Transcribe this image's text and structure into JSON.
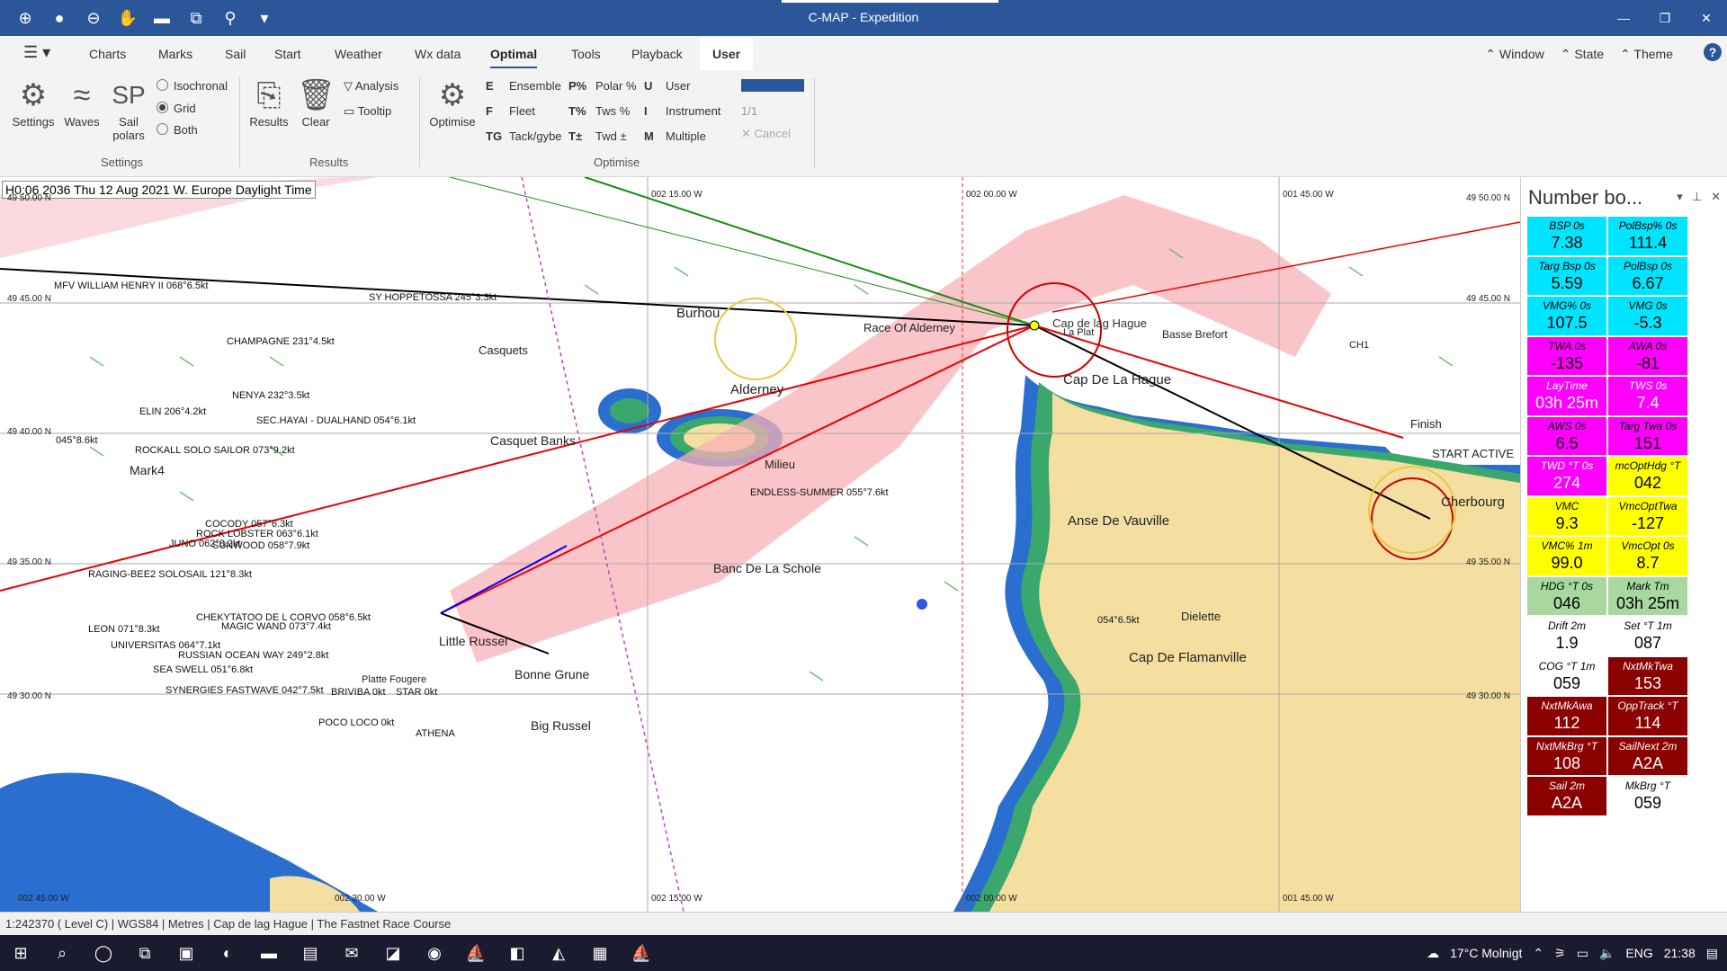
{
  "window": {
    "title": "C-MAP - Expedition"
  },
  "quick_access": [
    "zoom-in-icon",
    "circle-icon",
    "zoom-out-icon",
    "hand-icon",
    "eraser-icon",
    "frame-icon",
    "route-icon",
    "dropdown-icon"
  ],
  "tabs": [
    "Charts",
    "Marks",
    "Sail",
    "Start",
    "Weather",
    "Wx data",
    "Optimal",
    "Tools",
    "Playback",
    "User"
  ],
  "tab_right": {
    "window": "Window",
    "state": "State",
    "theme": "Theme",
    "help": "?"
  },
  "ribbon": {
    "settings": "Settings",
    "waves": "Waves",
    "sail_polars_icon": "SP",
    "sail_polars": "Sail polars",
    "isochronal": "Isochronal",
    "grid": "Grid",
    "both": "Both",
    "settings_group": "Settings",
    "results": "Results",
    "clear": "Clear",
    "analysis": "Analysis",
    "tooltip": "Tooltip",
    "results_group": "Results",
    "optimise": "Optimise",
    "opt_items": [
      {
        "key": "E",
        "label": "Ensemble"
      },
      {
        "key": "F",
        "label": "Fleet"
      },
      {
        "key": "TG",
        "label": "Tack/gybe"
      },
      {
        "key": "P%",
        "label": "Polar %"
      },
      {
        "key": "T%",
        "label": "Tws %"
      },
      {
        "key": "T±",
        "label": "Twd ±"
      },
      {
        "key": "U",
        "label": "User"
      },
      {
        "key": "I",
        "label": "Instrument"
      },
      {
        "key": "M",
        "label": "Multiple"
      }
    ],
    "progress": "1/1",
    "cancel": "Cancel",
    "optimise_group": "Optimise"
  },
  "map": {
    "header": "H0:06 2036 Thu 12 Aug 2021 W. Europe Daylight Time",
    "places": [
      "Burhou",
      "Race Of Alderney",
      "Cap de lag Hague",
      "La Plat",
      "Basse Brefort",
      "Cap De La Hague",
      "Alderney",
      "Casquet Banks",
      "Casquets",
      "Milieu",
      "Anse De Vauville",
      "Banc De La Schole",
      "Little Russel",
      "Bonne Grune",
      "Big Russel",
      "Dielette",
      "Cap De Flamanville",
      "Cherbourg",
      "Finish",
      "START ACTIVE",
      "CH1",
      "Mark4",
      "Platte Fougere"
    ],
    "coords": [
      "49 50.00 N",
      "49 45.00 N",
      "49 40.00 N",
      "49 35.00 N",
      "49 30.00 N",
      "002 15.00 W",
      "002 00.00 W",
      "001 45.00 W",
      "002 45.00 W",
      "002 30.00 W"
    ],
    "boats": [
      "MFV WILLIAM HENRY II 068°6.5kt",
      "SY HOPPETOSSA 245°3.3kt",
      "CHAMPAGNE 231°4.5kt",
      "NENYA 232°3.5kt",
      "ELIN 206°4.2kt",
      "SEC.HAYAI - DUALHAND 054°6.1kt",
      "ROCKALL SOLO SAILOR 073°9.2kt",
      "045°8.6kt",
      "ENDLESS-SUMMER 055°7.6kt",
      "COCODY 057°6.3kt",
      "ROCK LOBSTER 063°6.1kt",
      "JUNO 062°8.2kt",
      "SUNWOOD 058°7.9kt",
      "RAGING-BEE2 SOLOSAIL 121°8.3kt",
      "CHEKYTATOO DE L CORVO 058°6.5kt",
      "MAGIC WAND 073°7.4kt",
      "LEON 071°8.3kt",
      "UNIVERSITAS 064°7.1kt",
      "RUSSIAN OCEAN WAY 249°2.8kt",
      "SEA SWELL 051°6.8kt",
      "SYNERGIES FASTWAVE 042°7.5kt",
      "BRIVIBA 0kt",
      "STAR 0kt",
      "POCO LOCO 0kt",
      "ATHENA",
      "054°6.5kt"
    ]
  },
  "number_board": {
    "title": "Number bo...",
    "cells": [
      {
        "label": "BSP 0s",
        "value": "7.38",
        "bg": "#00e5ff",
        "fg": "#000"
      },
      {
        "label": "PolBsp% 0s",
        "value": "111.4",
        "bg": "#00e5ff",
        "fg": "#000"
      },
      {
        "label": "Targ Bsp 0s",
        "value": "5.59",
        "bg": "#00e5ff",
        "fg": "#000"
      },
      {
        "label": "PolBsp 0s",
        "value": "6.67",
        "bg": "#00e5ff",
        "fg": "#000"
      },
      {
        "label": "VMG% 0s",
        "value": "107.5",
        "bg": "#00e5ff",
        "fg": "#000"
      },
      {
        "label": "VMG 0s",
        "value": "-5.3",
        "bg": "#00e5ff",
        "fg": "#000"
      },
      {
        "label": "TWA 0s",
        "value": "-135",
        "bg": "#ff00ff",
        "fg": "#000"
      },
      {
        "label": "AWA 0s",
        "value": "-81",
        "bg": "#ff00ff",
        "fg": "#000"
      },
      {
        "label": "LayTime",
        "value": "03h 25m",
        "bg": "#ff00ff",
        "fg": "#fff"
      },
      {
        "label": "TWS 0s",
        "value": "7.4",
        "bg": "#ff00ff",
        "fg": "#fff"
      },
      {
        "label": "AWS 0s",
        "value": "6.5",
        "bg": "#ff00ff",
        "fg": "#000"
      },
      {
        "label": "Targ Twa 0s",
        "value": "151",
        "bg": "#ff00ff",
        "fg": "#000"
      },
      {
        "label": "TWD °T 0s",
        "value": "274",
        "bg": "#ff00ff",
        "fg": "#fff"
      },
      {
        "label": "mcOptHdg °T",
        "value": "042",
        "bg": "#ffff00",
        "fg": "#000"
      },
      {
        "label": "VMC",
        "value": "9.3",
        "bg": "#ffff00",
        "fg": "#000"
      },
      {
        "label": "VmcOptTwa",
        "value": "-127",
        "bg": "#ffff00",
        "fg": "#000"
      },
      {
        "label": "VMC% 1m",
        "value": "99.0",
        "bg": "#ffff00",
        "fg": "#000"
      },
      {
        "label": "VmcOpt 0s",
        "value": "8.7",
        "bg": "#ffff00",
        "fg": "#000"
      },
      {
        "label": "HDG °T 0s",
        "value": "046",
        "bg": "#a8d8a0",
        "fg": "#000"
      },
      {
        "label": "Mark Tm",
        "value": "03h 25m",
        "bg": "#a8d8a0",
        "fg": "#000"
      },
      {
        "label": "Drift 2m",
        "value": "1.9",
        "bg": "#ffffff",
        "fg": "#000"
      },
      {
        "label": "Set °T 1m",
        "value": "087",
        "bg": "#ffffff",
        "fg": "#000"
      },
      {
        "label": "COG °T 1m",
        "value": "059",
        "bg": "#ffffff",
        "fg": "#000"
      },
      {
        "label": "NxtMkTwa",
        "value": "153",
        "bg": "#8b0000",
        "fg": "#fff"
      },
      {
        "label": "NxtMkAwa",
        "value": "112",
        "bg": "#8b0000",
        "fg": "#fff"
      },
      {
        "label": "OppTrack °T",
        "value": "114",
        "bg": "#8b0000",
        "fg": "#fff"
      },
      {
        "label": "NxtMkBrg °T",
        "value": "108",
        "bg": "#8b0000",
        "fg": "#fff"
      },
      {
        "label": "SailNext 2m",
        "value": "A2A",
        "bg": "#8b0000",
        "fg": "#fff"
      },
      {
        "label": "Sail 2m",
        "value": "A2A",
        "bg": "#8b0000",
        "fg": "#fff"
      },
      {
        "label": "MkBrg °T",
        "value": "059",
        "bg": "#ffffff",
        "fg": "#000"
      }
    ]
  },
  "status_bar": "1:242370 ( Level C) | WGS84 | Metres | Cap de lag Hague | The Fastnet Race Course",
  "taskbar": {
    "weather": "17°C  Molnigt",
    "lang": "ENG",
    "time": "21:38"
  }
}
